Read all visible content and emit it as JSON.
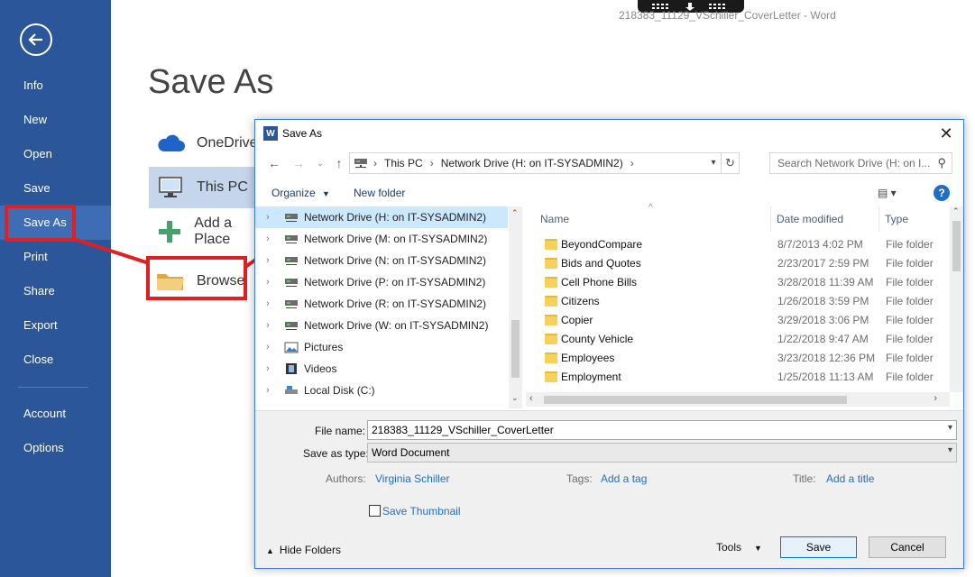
{
  "window": {
    "title": "218383_11129_VSchiller_CoverLetter - Word"
  },
  "backstage": {
    "back_icon": "back-arrow-icon",
    "menu": [
      {
        "label": "Info"
      },
      {
        "label": "New"
      },
      {
        "label": "Open"
      },
      {
        "label": "Save"
      },
      {
        "label": "Save As",
        "active": true
      },
      {
        "label": "Print"
      },
      {
        "label": "Share"
      },
      {
        "label": "Export"
      },
      {
        "label": "Close"
      },
      {
        "label": "Account"
      },
      {
        "label": "Options"
      }
    ],
    "title": "Save As",
    "places": [
      {
        "label": "OneDrive",
        "icon": "cloud-icon"
      },
      {
        "label": "This PC",
        "icon": "computer-icon",
        "selected": true
      },
      {
        "label": "Add a Place",
        "icon": "plus-icon"
      },
      {
        "label": "Browse",
        "icon": "folder-icon"
      }
    ]
  },
  "dialog": {
    "title": "Save As",
    "address": {
      "parts": [
        "This PC",
        "Network Drive (H: on IT-SYSADMIN2)"
      ]
    },
    "search": {
      "placeholder": "Search Network Drive (H: on I..."
    },
    "toolbar": {
      "organize": "Organize",
      "new_folder": "New folder"
    },
    "nav_items": [
      {
        "label": "Network Drive (H: on IT-SYSADMIN2)",
        "icon": "network-drive-icon",
        "selected": true
      },
      {
        "label": "Network Drive (M: on IT-SYSADMIN2)",
        "icon": "network-drive-icon"
      },
      {
        "label": "Network Drive (N: on IT-SYSADMIN2)",
        "icon": "network-drive-icon"
      },
      {
        "label": "Network Drive (P: on IT-SYSADMIN2)",
        "icon": "network-drive-icon"
      },
      {
        "label": "Network Drive (R: on IT-SYSADMIN2)",
        "icon": "network-drive-icon"
      },
      {
        "label": "Network Drive (W: on IT-SYSADMIN2)",
        "icon": "network-drive-icon"
      },
      {
        "label": "Pictures",
        "icon": "pictures-icon"
      },
      {
        "label": "Videos",
        "icon": "videos-icon"
      },
      {
        "label": "Local Disk (C:)",
        "icon": "local-disk-icon"
      }
    ],
    "columns": {
      "name": "Name",
      "date": "Date modified",
      "type": "Type"
    },
    "files": [
      {
        "name": "BeyondCompare",
        "date": "8/7/2013 4:02 PM",
        "type": "File folder"
      },
      {
        "name": "Bids and Quotes",
        "date": "2/23/2017 2:59 PM",
        "type": "File folder"
      },
      {
        "name": "Cell Phone Bills",
        "date": "3/28/2018 11:39 AM",
        "type": "File folder"
      },
      {
        "name": "Citizens",
        "date": "1/26/2018 3:59 PM",
        "type": "File folder"
      },
      {
        "name": "Copier",
        "date": "3/29/2018 3:06 PM",
        "type": "File folder"
      },
      {
        "name": "County Vehicle",
        "date": "1/22/2018 9:47 AM",
        "type": "File folder"
      },
      {
        "name": "Employees",
        "date": "3/23/2018 12:36 PM",
        "type": "File folder"
      },
      {
        "name": "Employment",
        "date": "1/25/2018 11:13 AM",
        "type": "File folder"
      }
    ],
    "form": {
      "file_name_label": "File name:",
      "file_name_value": "218383_11129_VSchiller_CoverLetter",
      "save_type_label": "Save as type:",
      "save_type_value": "Word Document",
      "authors_label": "Authors:",
      "authors_value": "Virginia Schiller",
      "tags_label": "Tags:",
      "tags_value": "Add a tag",
      "title_label": "Title:",
      "title_value": "Add a title",
      "thumbnail_label": "Save Thumbnail"
    },
    "hide_folders": "Hide Folders",
    "tools": "Tools",
    "save": "Save",
    "cancel": "Cancel"
  }
}
